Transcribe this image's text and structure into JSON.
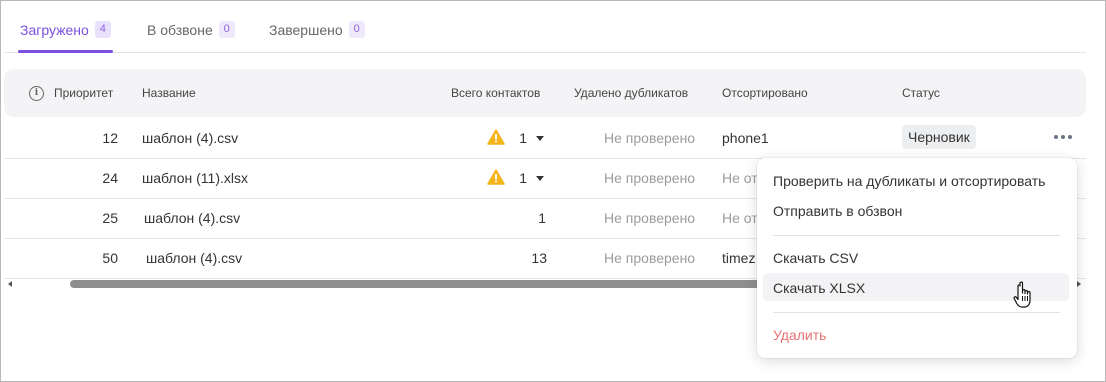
{
  "tabs": [
    {
      "label": "Загружено",
      "count": "4"
    },
    {
      "label": "В обзвоне",
      "count": "0"
    },
    {
      "label": "Завершено",
      "count": "0"
    }
  ],
  "table": {
    "headers": {
      "priority": "Приоритет",
      "name": "Название",
      "total_contacts": "Всего контактов",
      "duplicates_removed": "Удалено дубликатов",
      "sorted": "Отсортировано",
      "status": "Статус"
    },
    "rows": [
      {
        "priority": "12",
        "name": "шаблон (4).csv",
        "total": "1",
        "warning": true,
        "duplicates": "Не проверено",
        "sorted": "phone1",
        "status": "Черновик"
      },
      {
        "priority": "24",
        "name": "шаблон (11).xlsx",
        "total": "1",
        "warning": true,
        "duplicates": "Не проверено",
        "sorted": "Не от",
        "status": ""
      },
      {
        "priority": "25",
        "name": "шаблон (4).csv",
        "total": "1",
        "warning": false,
        "duplicates": "Не проверено",
        "sorted": "Не от",
        "status": ""
      },
      {
        "priority": "50",
        "name": "шаблон (4).csv",
        "total": "13",
        "warning": false,
        "duplicates": "Не проверено",
        "sorted": "timez",
        "status": ""
      }
    ]
  },
  "menu": {
    "check_duplicates": "Проверить на дубликаты и отсортировать",
    "send_to_call": "Отправить в обзвон",
    "download_csv": "Скачать CSV",
    "download_xlsx": "Скачать XLSX",
    "delete": "Удалить"
  },
  "icons": {
    "info": "info-icon",
    "warning": "warning-icon",
    "more": "more-horizontal-icon",
    "cursor": "hand-pointer-icon"
  },
  "colors": {
    "accent": "#7b4fe0",
    "warning": "#f5b21a",
    "danger": "#e57373",
    "muted_text": "#9b9b9b"
  }
}
